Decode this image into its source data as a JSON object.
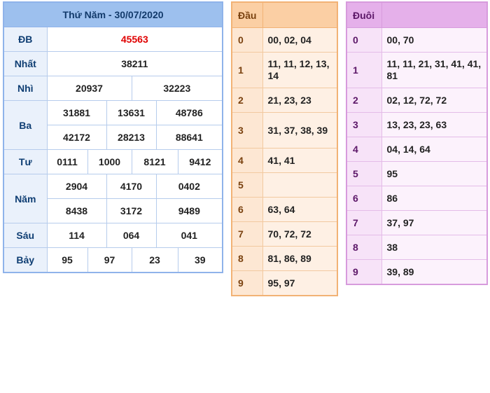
{
  "results": {
    "title": "Thứ Năm - 30/07/2020",
    "rows": [
      {
        "label": "ĐB",
        "values": [
          "45563"
        ]
      },
      {
        "label": "Nhất",
        "values": [
          "38211"
        ]
      },
      {
        "label": "Nhì",
        "values": [
          "20937",
          "32223"
        ]
      },
      {
        "label": "Ba",
        "values": [
          "31881",
          "13631",
          "48786",
          "42172",
          "28213",
          "88641"
        ]
      },
      {
        "label": "Tư",
        "values": [
          "0111",
          "1000",
          "8121",
          "9412"
        ]
      },
      {
        "label": "Năm",
        "values": [
          "2904",
          "4170",
          "0402",
          "8438",
          "3172",
          "9489"
        ]
      },
      {
        "label": "Sáu",
        "values": [
          "114",
          "064",
          "041"
        ]
      },
      {
        "label": "Bảy",
        "values": [
          "95",
          "97",
          "23",
          "39"
        ]
      }
    ],
    "special_color": "#e00000"
  },
  "dau": {
    "header": "Đầu",
    "rows": [
      {
        "k": "0",
        "v": "00, 02, 04"
      },
      {
        "k": "1",
        "v": "11, 11, 12, 13, 14"
      },
      {
        "k": "2",
        "v": "21, 23, 23"
      },
      {
        "k": "3",
        "v": "31, 37, 38, 39"
      },
      {
        "k": "4",
        "v": "41, 41"
      },
      {
        "k": "5",
        "v": ""
      },
      {
        "k": "6",
        "v": "63, 64"
      },
      {
        "k": "7",
        "v": "70, 72, 72"
      },
      {
        "k": "8",
        "v": "81, 86, 89"
      },
      {
        "k": "9",
        "v": "95, 97"
      }
    ]
  },
  "duoi": {
    "header": "Đuôi",
    "rows": [
      {
        "k": "0",
        "v": "00, 70"
      },
      {
        "k": "1",
        "v": "11, 11, 21, 31, 41, 41, 81"
      },
      {
        "k": "2",
        "v": "02, 12, 72, 72"
      },
      {
        "k": "3",
        "v": "13, 23, 23, 63"
      },
      {
        "k": "4",
        "v": "04, 14, 64"
      },
      {
        "k": "5",
        "v": "95"
      },
      {
        "k": "6",
        "v": "86"
      },
      {
        "k": "7",
        "v": "37, 97"
      },
      {
        "k": "8",
        "v": "38"
      },
      {
        "k": "9",
        "v": "39, 89"
      }
    ]
  }
}
